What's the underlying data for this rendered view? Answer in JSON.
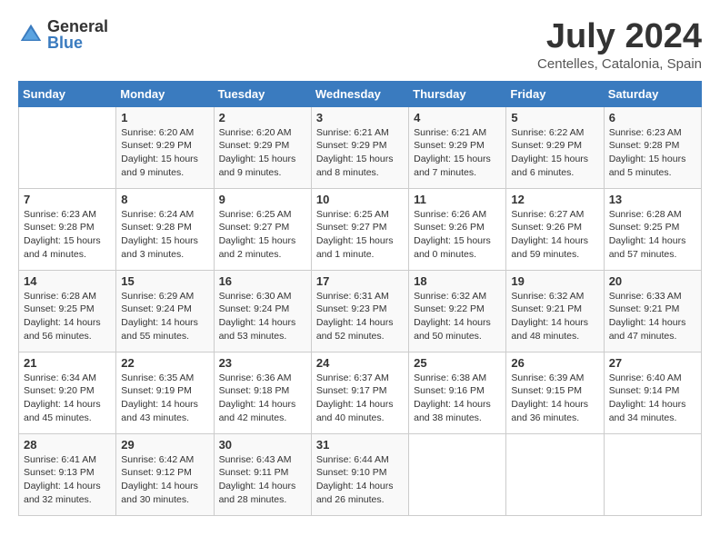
{
  "header": {
    "logo_general": "General",
    "logo_blue": "Blue",
    "month_year": "July 2024",
    "location": "Centelles, Catalonia, Spain"
  },
  "calendar": {
    "weekdays": [
      "Sunday",
      "Monday",
      "Tuesday",
      "Wednesday",
      "Thursday",
      "Friday",
      "Saturday"
    ],
    "weeks": [
      [
        {
          "day": "",
          "sunrise": "",
          "sunset": "",
          "daylight": ""
        },
        {
          "day": "1",
          "sunrise": "Sunrise: 6:20 AM",
          "sunset": "Sunset: 9:29 PM",
          "daylight": "Daylight: 15 hours and 9 minutes."
        },
        {
          "day": "2",
          "sunrise": "Sunrise: 6:20 AM",
          "sunset": "Sunset: 9:29 PM",
          "daylight": "Daylight: 15 hours and 9 minutes."
        },
        {
          "day": "3",
          "sunrise": "Sunrise: 6:21 AM",
          "sunset": "Sunset: 9:29 PM",
          "daylight": "Daylight: 15 hours and 8 minutes."
        },
        {
          "day": "4",
          "sunrise": "Sunrise: 6:21 AM",
          "sunset": "Sunset: 9:29 PM",
          "daylight": "Daylight: 15 hours and 7 minutes."
        },
        {
          "day": "5",
          "sunrise": "Sunrise: 6:22 AM",
          "sunset": "Sunset: 9:29 PM",
          "daylight": "Daylight: 15 hours and 6 minutes."
        },
        {
          "day": "6",
          "sunrise": "Sunrise: 6:23 AM",
          "sunset": "Sunset: 9:28 PM",
          "daylight": "Daylight: 15 hours and 5 minutes."
        }
      ],
      [
        {
          "day": "7",
          "sunrise": "Sunrise: 6:23 AM",
          "sunset": "Sunset: 9:28 PM",
          "daylight": "Daylight: 15 hours and 4 minutes."
        },
        {
          "day": "8",
          "sunrise": "Sunrise: 6:24 AM",
          "sunset": "Sunset: 9:28 PM",
          "daylight": "Daylight: 15 hours and 3 minutes."
        },
        {
          "day": "9",
          "sunrise": "Sunrise: 6:25 AM",
          "sunset": "Sunset: 9:27 PM",
          "daylight": "Daylight: 15 hours and 2 minutes."
        },
        {
          "day": "10",
          "sunrise": "Sunrise: 6:25 AM",
          "sunset": "Sunset: 9:27 PM",
          "daylight": "Daylight: 15 hours and 1 minute."
        },
        {
          "day": "11",
          "sunrise": "Sunrise: 6:26 AM",
          "sunset": "Sunset: 9:26 PM",
          "daylight": "Daylight: 15 hours and 0 minutes."
        },
        {
          "day": "12",
          "sunrise": "Sunrise: 6:27 AM",
          "sunset": "Sunset: 9:26 PM",
          "daylight": "Daylight: 14 hours and 59 minutes."
        },
        {
          "day": "13",
          "sunrise": "Sunrise: 6:28 AM",
          "sunset": "Sunset: 9:25 PM",
          "daylight": "Daylight: 14 hours and 57 minutes."
        }
      ],
      [
        {
          "day": "14",
          "sunrise": "Sunrise: 6:28 AM",
          "sunset": "Sunset: 9:25 PM",
          "daylight": "Daylight: 14 hours and 56 minutes."
        },
        {
          "day": "15",
          "sunrise": "Sunrise: 6:29 AM",
          "sunset": "Sunset: 9:24 PM",
          "daylight": "Daylight: 14 hours and 55 minutes."
        },
        {
          "day": "16",
          "sunrise": "Sunrise: 6:30 AM",
          "sunset": "Sunset: 9:24 PM",
          "daylight": "Daylight: 14 hours and 53 minutes."
        },
        {
          "day": "17",
          "sunrise": "Sunrise: 6:31 AM",
          "sunset": "Sunset: 9:23 PM",
          "daylight": "Daylight: 14 hours and 52 minutes."
        },
        {
          "day": "18",
          "sunrise": "Sunrise: 6:32 AM",
          "sunset": "Sunset: 9:22 PM",
          "daylight": "Daylight: 14 hours and 50 minutes."
        },
        {
          "day": "19",
          "sunrise": "Sunrise: 6:32 AM",
          "sunset": "Sunset: 9:21 PM",
          "daylight": "Daylight: 14 hours and 48 minutes."
        },
        {
          "day": "20",
          "sunrise": "Sunrise: 6:33 AM",
          "sunset": "Sunset: 9:21 PM",
          "daylight": "Daylight: 14 hours and 47 minutes."
        }
      ],
      [
        {
          "day": "21",
          "sunrise": "Sunrise: 6:34 AM",
          "sunset": "Sunset: 9:20 PM",
          "daylight": "Daylight: 14 hours and 45 minutes."
        },
        {
          "day": "22",
          "sunrise": "Sunrise: 6:35 AM",
          "sunset": "Sunset: 9:19 PM",
          "daylight": "Daylight: 14 hours and 43 minutes."
        },
        {
          "day": "23",
          "sunrise": "Sunrise: 6:36 AM",
          "sunset": "Sunset: 9:18 PM",
          "daylight": "Daylight: 14 hours and 42 minutes."
        },
        {
          "day": "24",
          "sunrise": "Sunrise: 6:37 AM",
          "sunset": "Sunset: 9:17 PM",
          "daylight": "Daylight: 14 hours and 40 minutes."
        },
        {
          "day": "25",
          "sunrise": "Sunrise: 6:38 AM",
          "sunset": "Sunset: 9:16 PM",
          "daylight": "Daylight: 14 hours and 38 minutes."
        },
        {
          "day": "26",
          "sunrise": "Sunrise: 6:39 AM",
          "sunset": "Sunset: 9:15 PM",
          "daylight": "Daylight: 14 hours and 36 minutes."
        },
        {
          "day": "27",
          "sunrise": "Sunrise: 6:40 AM",
          "sunset": "Sunset: 9:14 PM",
          "daylight": "Daylight: 14 hours and 34 minutes."
        }
      ],
      [
        {
          "day": "28",
          "sunrise": "Sunrise: 6:41 AM",
          "sunset": "Sunset: 9:13 PM",
          "daylight": "Daylight: 14 hours and 32 minutes."
        },
        {
          "day": "29",
          "sunrise": "Sunrise: 6:42 AM",
          "sunset": "Sunset: 9:12 PM",
          "daylight": "Daylight: 14 hours and 30 minutes."
        },
        {
          "day": "30",
          "sunrise": "Sunrise: 6:43 AM",
          "sunset": "Sunset: 9:11 PM",
          "daylight": "Daylight: 14 hours and 28 minutes."
        },
        {
          "day": "31",
          "sunrise": "Sunrise: 6:44 AM",
          "sunset": "Sunset: 9:10 PM",
          "daylight": "Daylight: 14 hours and 26 minutes."
        },
        {
          "day": "",
          "sunrise": "",
          "sunset": "",
          "daylight": ""
        },
        {
          "day": "",
          "sunrise": "",
          "sunset": "",
          "daylight": ""
        },
        {
          "day": "",
          "sunrise": "",
          "sunset": "",
          "daylight": ""
        }
      ]
    ]
  }
}
